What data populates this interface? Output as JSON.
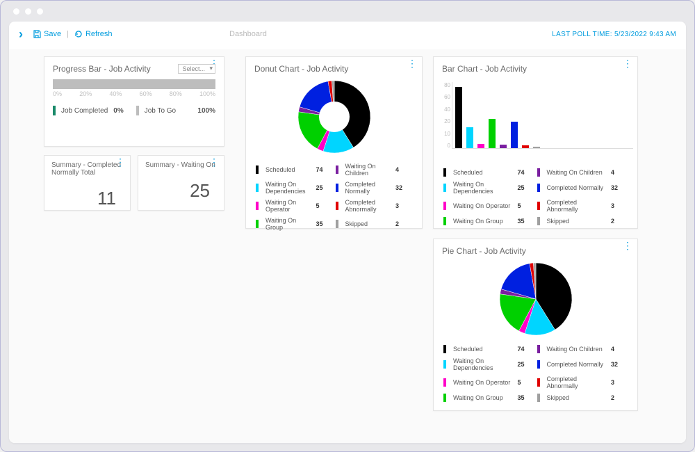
{
  "toolbar": {
    "save_label": "Save",
    "refresh_label": "Refresh",
    "breadcrumb": "Dashboard",
    "poll_prefix": "LAST POLL TIME: ",
    "poll_time": "5/23/2022 9:43 AM"
  },
  "progress_card": {
    "title": "Progress Bar - Job Activity",
    "select": "Select...",
    "ticks": [
      "0%",
      "20%",
      "40%",
      "60%",
      "80%",
      "100%"
    ],
    "completed_label": "Job Completed",
    "completed_val": "0%",
    "togo_label": "Job To Go",
    "togo_val": "100%"
  },
  "summary_completed": {
    "title": "Summary - Completed Normally Total",
    "value": "11"
  },
  "summary_waiting": {
    "title": "Summary - Waiting On",
    "value": "25"
  },
  "donut_card": {
    "title": "Donut Chart - Job Activity"
  },
  "bar_card": {
    "title": "Bar Chart - Job Activity"
  },
  "pie_card": {
    "title": "Pie Chart - Job Activity"
  },
  "legend": [
    {
      "label": "Scheduled",
      "value": 74,
      "color": "#000000"
    },
    {
      "label": "Waiting On Dependencies",
      "value": 25,
      "color": "#00d5ff"
    },
    {
      "label": "Waiting On Operator",
      "value": 5,
      "color": "#ff00c8"
    },
    {
      "label": "Waiting On Group",
      "value": 35,
      "color": "#00d000"
    },
    {
      "label": "Waiting On Children",
      "value": 4,
      "color": "#7a1fa0"
    },
    {
      "label": "Completed Normally",
      "value": 32,
      "color": "#0020e0"
    },
    {
      "label": "Completed Abnormally",
      "value": 3,
      "color": "#e00000"
    },
    {
      "label": "Skipped",
      "value": 2,
      "color": "#a0a0a0"
    }
  ],
  "bar_y_ticks": [
    "80",
    "60",
    "40",
    "20",
    "10",
    "0"
  ],
  "chart_data": [
    {
      "type": "pie",
      "title": "Donut Chart - Job Activity",
      "donut": true,
      "series": [
        {
          "name": "Scheduled",
          "value": 74,
          "color": "#000000"
        },
        {
          "name": "Waiting On Dependencies",
          "value": 25,
          "color": "#00d5ff"
        },
        {
          "name": "Waiting On Operator",
          "value": 5,
          "color": "#ff00c8"
        },
        {
          "name": "Waiting On Group",
          "value": 35,
          "color": "#00d000"
        },
        {
          "name": "Waiting On Children",
          "value": 4,
          "color": "#7a1fa0"
        },
        {
          "name": "Completed Normally",
          "value": 32,
          "color": "#0020e0"
        },
        {
          "name": "Completed Abnormally",
          "value": 3,
          "color": "#e00000"
        },
        {
          "name": "Skipped",
          "value": 2,
          "color": "#a0a0a0"
        }
      ]
    },
    {
      "type": "bar",
      "title": "Bar Chart - Job Activity",
      "ylim": [
        0,
        80
      ],
      "categories": [
        "Scheduled",
        "Waiting On Dependencies",
        "Waiting On Operator",
        "Waiting On Group",
        "Waiting On Children",
        "Completed Normally",
        "Completed Abnormally",
        "Skipped"
      ],
      "values": [
        74,
        25,
        5,
        35,
        4,
        32,
        3,
        2
      ],
      "colors": [
        "#000000",
        "#00d5ff",
        "#ff00c8",
        "#00d000",
        "#7a1fa0",
        "#0020e0",
        "#e00000",
        "#a0a0a0"
      ]
    },
    {
      "type": "pie",
      "title": "Pie Chart - Job Activity",
      "donut": false,
      "series": [
        {
          "name": "Scheduled",
          "value": 74,
          "color": "#000000"
        },
        {
          "name": "Waiting On Dependencies",
          "value": 25,
          "color": "#00d5ff"
        },
        {
          "name": "Waiting On Operator",
          "value": 5,
          "color": "#ff00c8"
        },
        {
          "name": "Waiting On Group",
          "value": 35,
          "color": "#00d000"
        },
        {
          "name": "Waiting On Children",
          "value": 4,
          "color": "#7a1fa0"
        },
        {
          "name": "Completed Normally",
          "value": 32,
          "color": "#0020e0"
        },
        {
          "name": "Completed Abnormally",
          "value": 3,
          "color": "#e00000"
        },
        {
          "name": "Skipped",
          "value": 2,
          "color": "#a0a0a0"
        }
      ]
    }
  ]
}
